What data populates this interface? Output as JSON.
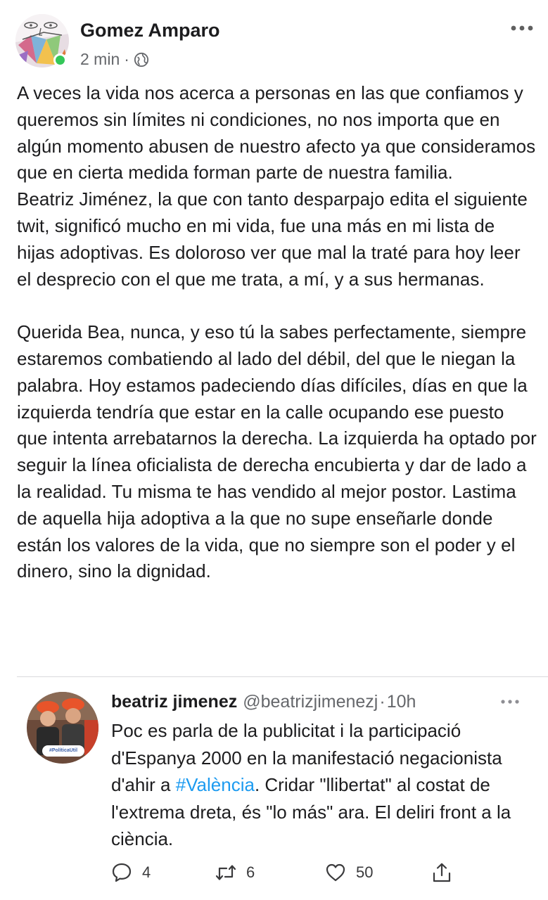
{
  "post": {
    "author": "Gomez Amparo",
    "time": "2 min",
    "separator": "·",
    "body": "A veces la vida nos acerca a personas en las que confiamos y queremos sin límites ni condiciones, no nos importa que en algún momento abusen de nuestro afecto ya que consideramos que en cierta medida forman parte de nuestra familia.\nBeatriz Jiménez, la que con tanto desparpajo edita el siguiente twit, significó mucho en mi vida, fue una más en mi lista de hijas adoptivas. Es doloroso ver que mal la traté para hoy leer el desprecio con el que me trata, a mí, y a sus hermanas.\n\nQuerida Bea, nunca, y eso tú la sabes perfectamente, siempre estaremos combatiendo al lado del débil, del que le niegan la palabra. Hoy estamos padeciendo días difíciles, días en que la izquierda tendría que estar en la calle ocupando ese puesto que intenta arrebatarnos la derecha. La izquierda ha optado por seguir la línea oficialista de derecha encubierta y dar de lado a la realidad. Tu misma te has vendido al mejor postor. Lastima de aquella hija adoptiva a la que no supe enseñarle donde están los valores de la vida, que no siempre son el poder y el dinero, sino la dignidad.",
    "online_color": "#34c759"
  },
  "tweet": {
    "name": "beatriz jimenez",
    "handle": "@beatrizjimenezj",
    "separator": "·",
    "time": "10h",
    "avatar_badge": "#PolíticaÚtil",
    "text_before": "Poc es parla de la publicitat i la participació d'Espanya 2000 en la manifestació negacionista d'ahir a ",
    "hashtag": "#València",
    "text_after": ".  Cridar \"llibertat\" al costat de l'extrema dreta, és \"lo más\" ara. El deliri front a la ciència.",
    "hashtag_color": "#1d9bf0",
    "replies": "4",
    "retweets": "6",
    "likes": "50"
  },
  "icons": {
    "more": "more-horizontal-icon",
    "globe": "globe-icon",
    "reply": "reply-icon",
    "retweet": "retweet-icon",
    "like": "heart-icon",
    "share": "share-icon"
  }
}
